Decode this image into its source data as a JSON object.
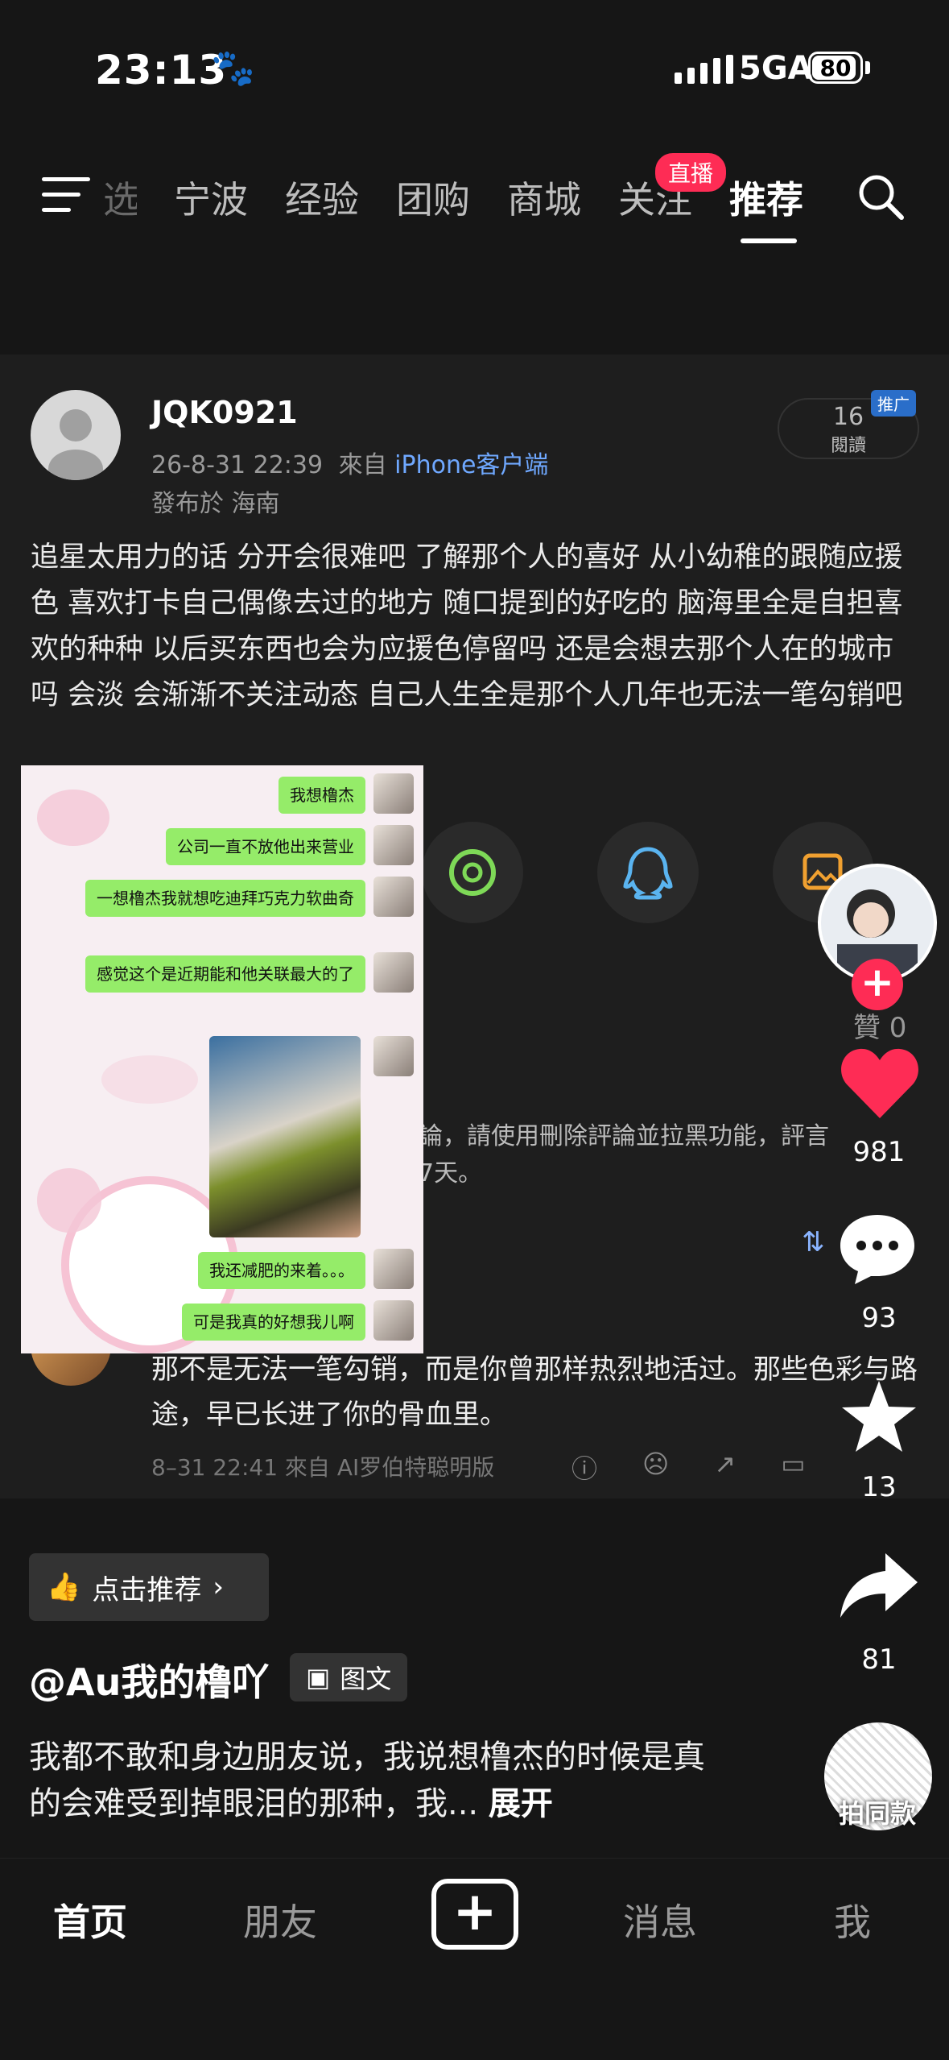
{
  "status_bar": {
    "time": "23:13",
    "network": "5GA",
    "battery": "80"
  },
  "top_nav": {
    "partial_tab": "选",
    "tabs": [
      "宁波",
      "经验",
      "团购",
      "商城",
      "关注",
      "推荐"
    ],
    "active_tab": "推荐",
    "live_badge": "直播"
  },
  "post": {
    "username": "JQK0921",
    "date": "26-8-31 22:39",
    "from_prefix": "來自",
    "client": "iPhone客户端",
    "location": "發布於 海南",
    "read_count": "16",
    "read_label": "閱讀",
    "promo_badge": "推广",
    "body": "追星太用力的话 分开会很难吧 了解那个人的喜好 从小幼稚的跟随应援色 喜欢打卡自己偶像去过的地方 随口提到的好吃的 脑海里全是自担喜欢的种种 以后买东西也会为应援色停留吗 还是会想去那个人在的城市吗 会淡 会渐渐不关注动态 自己人生全是那个人几年也无法一笔勾销吧",
    "likes_label": "贊 0",
    "warning_text": "論，請使用刪除評論並拉黑功能，評言7天。"
  },
  "chat_screenshot": {
    "messages": [
      "我想橹杰",
      "公司一直不放他出来营业",
      "一想橹杰我就想吃迪拜巧克力软曲奇",
      "感觉这个是近期能和他关联最大的了",
      "我还减肥的来着。。。",
      "可是我真的好想我儿啊"
    ]
  },
  "comment": {
    "text": "那不是无法一笔勾销，而是你曾那样热烈地活过。那些色彩与路途，早已长进了你的骨血里。",
    "meta": "8–31 22:41 來自 AI罗伯特聪明版"
  },
  "rail": {
    "like_count": "981",
    "comment_count": "93",
    "favorite_count": "13",
    "share_count": "81",
    "same_style_label": "拍同款"
  },
  "video_info": {
    "recommend_label": "点击推荐",
    "author": "@Au我的橹吖",
    "type_label": "图文",
    "description": "我都不敢和身边朋友说，我说想橹杰的时候是真的会难受到掉眼泪的那种，我...",
    "expand_label": "展开"
  },
  "tabbar": {
    "items": [
      "首页",
      "朋友",
      "消息",
      "我"
    ],
    "active": "首页"
  },
  "colors": {
    "accent": "#fe2c55",
    "link": "#6fa8ff",
    "chat_bubble": "#95ec69"
  }
}
